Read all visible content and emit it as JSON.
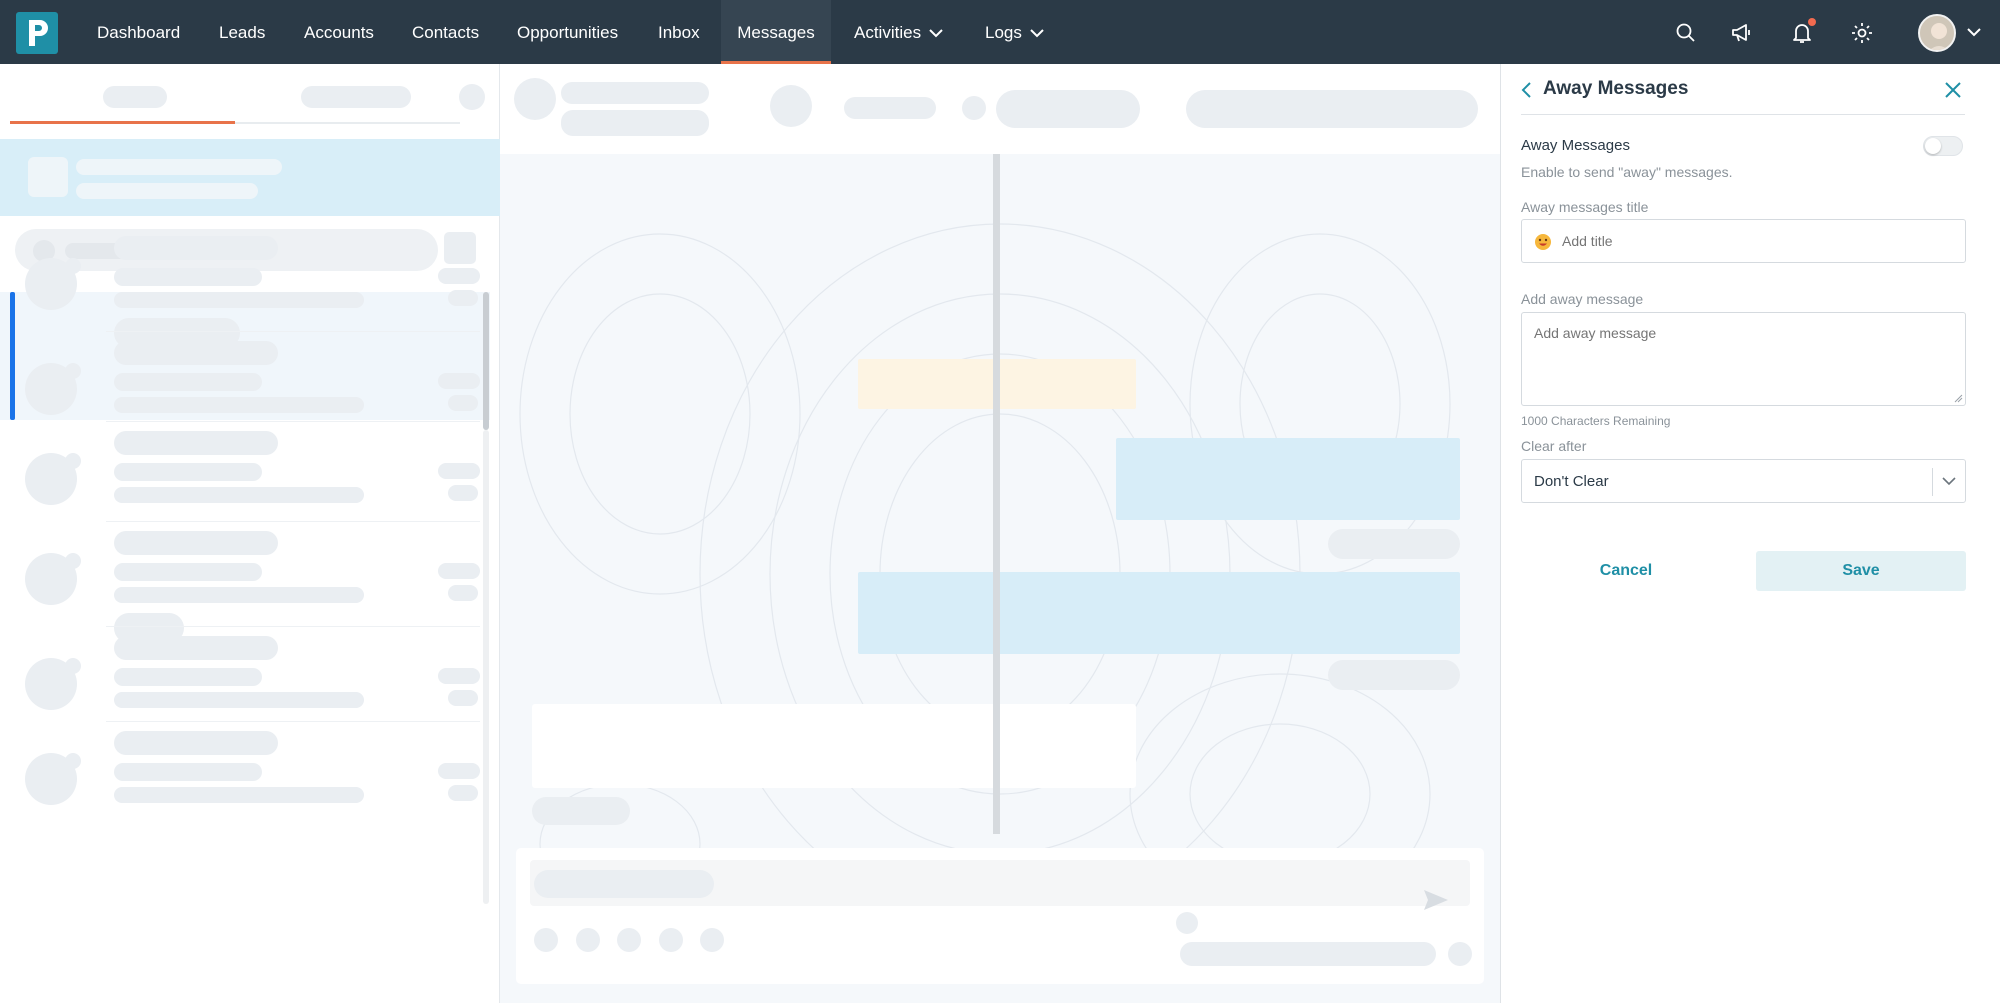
{
  "topnav": {
    "logo_letter": "P",
    "items": [
      {
        "label": "Dashboard"
      },
      {
        "label": "Leads"
      },
      {
        "label": "Accounts"
      },
      {
        "label": "Contacts"
      },
      {
        "label": "Opportunities"
      },
      {
        "label": "Inbox"
      },
      {
        "label": "Messages",
        "active": true
      },
      {
        "label": "Activities",
        "dropdown": true
      },
      {
        "label": "Logs",
        "dropdown": true
      }
    ],
    "icons": [
      "search-icon",
      "megaphone-icon",
      "bell-icon",
      "gear-icon"
    ],
    "has_notification": true
  },
  "away_panel": {
    "title": "Away Messages",
    "toggle_label": "Away Messages",
    "toggle_on": false,
    "toggle_hint": "Enable to send \"away\" messages.",
    "title_field_label": "Away messages title",
    "title_placeholder": "Add title",
    "message_field_label": "Add away message",
    "message_placeholder": "Add away message",
    "chars_remaining": "1000 Characters Remaining",
    "clear_after_label": "Clear after",
    "clear_after_value": "Don't Clear",
    "cancel_label": "Cancel",
    "save_label": "Save"
  },
  "colors": {
    "nav_bg": "#2b3a47",
    "accent": "#1f8fa6",
    "active_underline": "#e8734a",
    "skeleton": "#eaeef2"
  }
}
